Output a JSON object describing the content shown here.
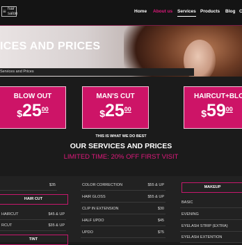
{
  "logo": {
    "line1": "hair",
    "line2": "salon",
    "mark": "≡"
  },
  "nav": {
    "items": [
      {
        "label": "Home"
      },
      {
        "label": "About us"
      },
      {
        "label": "Services"
      },
      {
        "label": "Products"
      },
      {
        "label": "Blog"
      },
      {
        "label": "C"
      }
    ]
  },
  "hero": {
    "title": "ICES AND PRICES",
    "breadcrumb": "Services and Prices"
  },
  "cards": [
    {
      "title": "BLOW OUT",
      "currency": "$",
      "amount": "25",
      "cents": "00"
    },
    {
      "title": "MAN'S CUT",
      "currency": "$",
      "amount": "25",
      "cents": "00"
    },
    {
      "title": "HAIRCUT+BLOW",
      "currency": "$",
      "amount": "59",
      "cents": "00"
    }
  ],
  "section": {
    "eyebrow": "THIS IS WHAT WE DO BEST",
    "title": "OUR SERVICES AND PRICES",
    "promo": "LIMITED TIME: 20% OFF FIRST VISIT"
  },
  "lists": {
    "left_top_price": "$35",
    "left_head": "HAIR CUT",
    "left_rows": [
      {
        "name": "HAIRCUT",
        "price": "$45 & UP"
      },
      {
        "name": "RCUT",
        "price": "$35 & UP"
      }
    ],
    "left_head2": "TINT",
    "middle_rows": [
      {
        "name": "COLOR CORRECTION",
        "price": "$55 & UP"
      },
      {
        "name": "HAIR GLOSS",
        "price": "$55 & UP"
      },
      {
        "name": "CLIP IN EXTENSION",
        "price": "$30"
      },
      {
        "name": "HALF UPDO",
        "price": "$45"
      },
      {
        "name": "UPDO",
        "price": "$75"
      }
    ],
    "right_head": "MAKEUP",
    "right_rows": [
      {
        "name": "BASIC",
        "price": ""
      },
      {
        "name": "EVENING",
        "price": ""
      },
      {
        "name": "EYELASH STRIP (EXTRA)",
        "price": ""
      },
      {
        "name": "EYELASH EXTENTION",
        "price": ""
      }
    ]
  },
  "colors": {
    "accent": "#e0197c",
    "card": "#cd1467",
    "background": "#1b1b1b"
  }
}
